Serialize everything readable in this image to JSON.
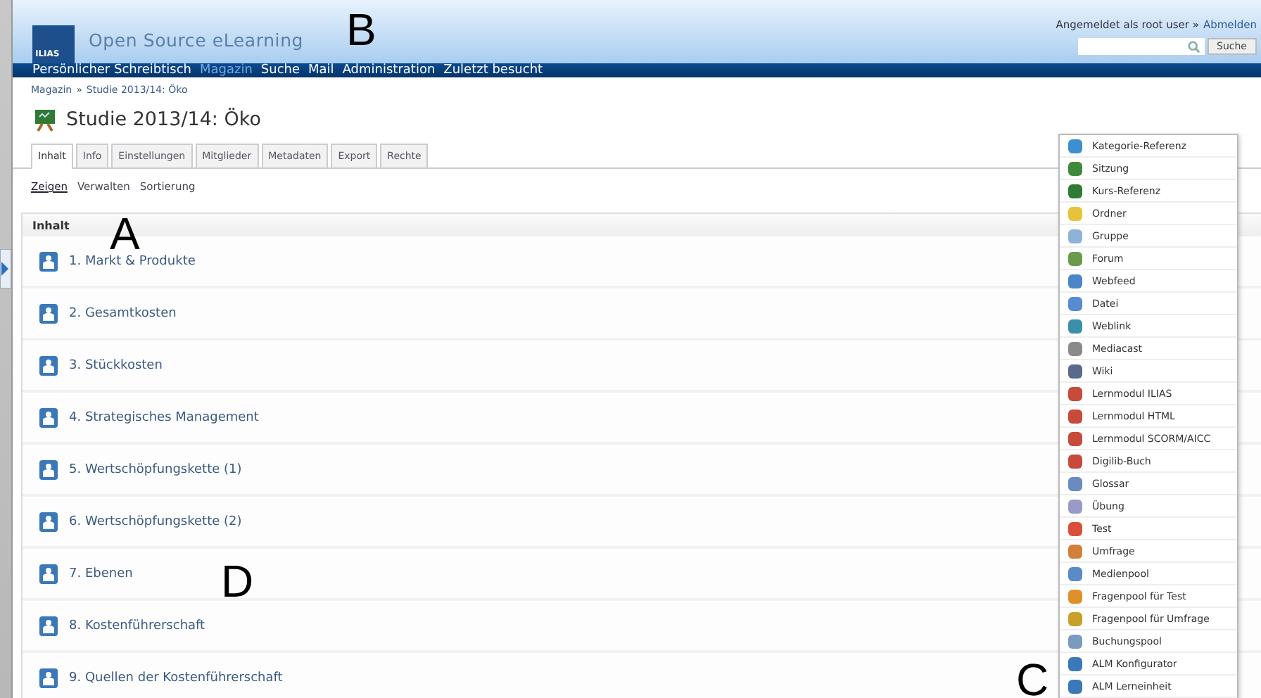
{
  "header": {
    "logo": "ILIAS",
    "title": "Open Source eLearning",
    "login_text": "Angemeldet als root user »",
    "logout_link": "Abmelden",
    "search": {
      "button": "Suche"
    }
  },
  "main_menu": [
    {
      "label": "Persönlicher Schreibtisch",
      "selected": false
    },
    {
      "label": "Magazin",
      "selected": true
    },
    {
      "label": "Suche",
      "selected": false
    },
    {
      "label": "Mail",
      "selected": false
    },
    {
      "label": "Administration",
      "selected": false
    },
    {
      "label": "Zuletzt besucht",
      "selected": false
    }
  ],
  "breadcrumb": [
    "Magazin",
    "»",
    "Studie 2013/14: Öko"
  ],
  "page_title": "Studie 2013/14: Öko",
  "tabs": [
    {
      "label": "Inhalt",
      "selected": true
    },
    {
      "label": "Info",
      "selected": false
    },
    {
      "label": "Einstellungen",
      "selected": false
    },
    {
      "label": "Mitglieder",
      "selected": false
    },
    {
      "label": "Metadaten",
      "selected": false
    },
    {
      "label": "Export",
      "selected": false
    },
    {
      "label": "Rechte",
      "selected": false
    }
  ],
  "subtabs": [
    {
      "label": "Zeigen",
      "selected": true
    },
    {
      "label": "Verwalten",
      "selected": false
    },
    {
      "label": "Sortierung",
      "selected": false
    }
  ],
  "content": {
    "heading": "Inhalt",
    "items": [
      "1. Markt & Produkte",
      "2. Gesamtkosten",
      "3. Stückkosten",
      "4. Strategisches Management",
      "5. Wertschöpfungskette (1)",
      "6. Wertschöpfungskette (2)",
      "7. Ebenen",
      "8. Kostenführerschaft",
      "9. Quellen der Kostenführerschaft"
    ]
  },
  "add_menu": [
    "Kategorie-Referenz",
    "Sitzung",
    "Kurs-Referenz",
    "Ordner",
    "Gruppe",
    "Forum",
    "Webfeed",
    "Datei",
    "Weblink",
    "Mediacast",
    "Wiki",
    "Lernmodul ILIAS",
    "Lernmodul HTML",
    "Lernmodul SCORM/AICC",
    "Digilib-Buch",
    "Glossar",
    "Übung",
    "Test",
    "Umfrage",
    "Medienpool",
    "Fragenpool für Test",
    "Fragenpool für Umfrage",
    "Buchungspool",
    "ALM Konfigurator",
    "ALM Lerneinheit"
  ],
  "annotations": [
    "B",
    "A",
    "D",
    "C"
  ]
}
